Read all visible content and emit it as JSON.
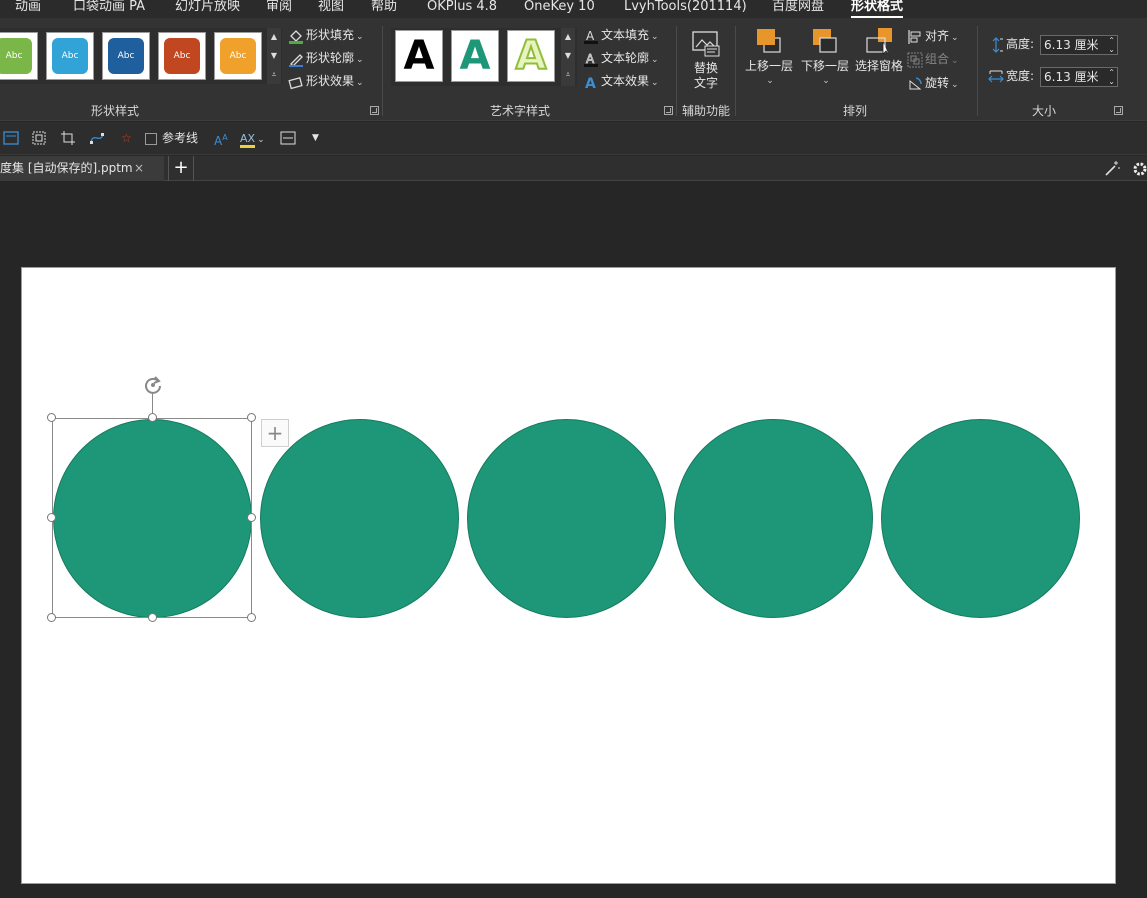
{
  "menu": {
    "tabs": [
      {
        "label": "动画"
      },
      {
        "label": "口袋动画 PA"
      },
      {
        "label": "幻灯片放映"
      },
      {
        "label": "审阅"
      },
      {
        "label": "视图"
      },
      {
        "label": "帮助"
      },
      {
        "label": "OKPlus 4.8"
      },
      {
        "label": "OneKey 10"
      },
      {
        "label": "LvyhTools(201114)"
      },
      {
        "label": "百度网盘"
      },
      {
        "label": "形状格式",
        "active": true
      }
    ]
  },
  "ribbon": {
    "shape_styles": {
      "label": "形状样式",
      "swatches": [
        {
          "text": "Abc",
          "color": "#7ab648"
        },
        {
          "text": "Abc",
          "color": "#32a3d6"
        },
        {
          "text": "Abc",
          "color": "#1f5f9d"
        },
        {
          "text": "Abc",
          "color": "#c0471f"
        },
        {
          "text": "Abc",
          "color": "#f0a12b"
        }
      ],
      "fill": "形状填充",
      "outline": "形状轮廓",
      "effects": "形状效果"
    },
    "wordart": {
      "label": "艺术字样式",
      "samples": [
        "A",
        "A",
        "A"
      ],
      "text_fill": "文本填充",
      "text_outline": "文本轮廓",
      "text_effects": "文本效果"
    },
    "accessibility": {
      "label": "辅助功能",
      "alt_text_line1": "替换",
      "alt_text_line2": "文字"
    },
    "arrange": {
      "label": "排列",
      "bring_forward": "上移一层",
      "send_backward": "下移一层",
      "selection_pane": "选择窗格",
      "align": "对齐",
      "group": "组合",
      "rotate": "旋转"
    },
    "size": {
      "label": "大小",
      "height_label": "高度:",
      "height_value": "6.13 厘米",
      "width_label": "宽度:",
      "width_value": "6.13 厘米"
    }
  },
  "toolbar2": {
    "guides_label": "参考线"
  },
  "doc_tab": {
    "title": "度集 [自动保存的].pptm",
    "close": "×",
    "new_tab": "+"
  },
  "slide": {
    "shape_color": "#1e9778",
    "circle_count": 5,
    "layout_options_symbol": "+"
  }
}
